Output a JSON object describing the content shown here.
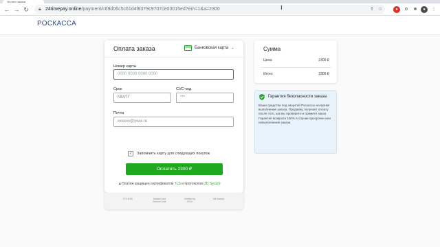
{
  "browser": {
    "tab_title": "Оплата заказа",
    "url_domain": "24timepay.online",
    "url_path": "/payment/c69d06c5c61d4f8379c9707ce03015ed?em=1&a=2300"
  },
  "header": {
    "logo": "РОСКАССА"
  },
  "payment": {
    "title": "Оплата заказа",
    "method": "Банковская карта",
    "card_number_label": "Номер карты",
    "card_number_placeholder": "0000 0000 0000 0000",
    "expiry_label": "Срок",
    "expiry_placeholder": "ММ/ГГ",
    "cvc_label": "CVC-код",
    "cvc_placeholder": "***",
    "email_label": "Почта",
    "email_placeholder": "xxxxxx@xxxx.ru",
    "remember_label": "Запомнить карту для следующих покупок",
    "remember_checked": true,
    "pay_button": "Оплатить 2300 ₽",
    "secure_prefix": "Платеж защищен сертификатом",
    "secure_tls": "TLS",
    "secure_mid": "и протоколом",
    "secure_3ds": "3D Secure",
    "badges": [
      "PCI DSS",
      "MasterCard SecureCode",
      "Verified by VISA",
      "Mir Accept"
    ]
  },
  "summary": {
    "title": "Сумма",
    "price_label": "Цена:",
    "price_value": "2300 ₽",
    "total_label": "Итого:",
    "total_value": "2300 ₽"
  },
  "guarantee": {
    "title": "Гарантия безопасности заказа",
    "text": "Ваши средства под защитой Роскассы на время выполнения заказа. Продавец получает оплату после того, как вы проверите и примете заказ. Гарантия возврата 100% в случае просрочки или невыполнения заказа"
  },
  "colors": {
    "accent": "#1ea81e",
    "logo": "#2a4a8b",
    "focus": "#2b5fd9",
    "info_bg": "#e8f2fa"
  }
}
